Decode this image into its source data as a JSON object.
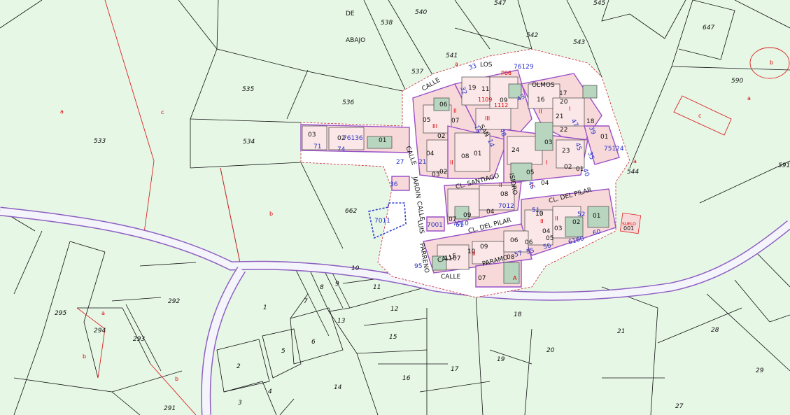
{
  "map": {
    "parcel_numbers": [
      "540",
      "547",
      "545",
      "647",
      "538",
      "542",
      "543",
      "541",
      "537",
      "590",
      "535",
      "536",
      "533",
      "534",
      "591",
      "544",
      "662",
      "295",
      "292",
      "294",
      "293",
      "291",
      "1",
      "2",
      "3",
      "4",
      "5",
      "6",
      "7",
      "8",
      "9",
      "10",
      "11",
      "12",
      "13",
      "14",
      "15",
      "16",
      "17",
      "18",
      "19",
      "20",
      "21",
      "27",
      "28",
      "29"
    ],
    "subparcel_letters": [
      "a",
      "b",
      "c"
    ],
    "street_labels": [
      "DE",
      "ABAJO",
      "CALLE",
      "LOS",
      "OLMOS",
      "CALLE",
      "SAN",
      "ISIDRO",
      "CL. SANTIAGO",
      "CL. DEL PILAR",
      "CL. DEL PILAR",
      "CALLE",
      "JARDIN",
      "CALLE",
      "LUIS",
      "PARRENO",
      "CALLE",
      "PARAMO"
    ],
    "building_numbers": [
      "03",
      "02",
      "01",
      "05",
      "06",
      "07",
      "19",
      "11",
      "09",
      "16",
      "17",
      "20",
      "21",
      "22",
      "23",
      "18",
      "01",
      "02",
      "04",
      "03",
      "02",
      "08",
      "01",
      "24",
      "05",
      "03",
      "04",
      "08",
      "01",
      "02",
      "07",
      "09",
      "10",
      "13",
      "06",
      "05",
      "04",
      "03",
      "02",
      "04",
      "01",
      "07",
      "10",
      "09",
      "11",
      "06",
      "07",
      "08"
    ],
    "blue_labels": [
      "71",
      "74",
      "76136",
      "27",
      "21",
      "75124",
      "33",
      "32",
      "15",
      "14",
      "48",
      "43",
      "47",
      "46",
      "45",
      "40",
      "39",
      "35",
      "36",
      "7001",
      "7011",
      "7010",
      "61",
      "6160",
      "56",
      "55",
      "57",
      "60",
      "95",
      "51",
      "52",
      "7012",
      "76129",
      "7901",
      "7600"
    ],
    "red_labels": [
      "P06",
      "1109",
      "1112",
      "III",
      "II",
      "I",
      "A"
    ],
    "suelo_label": "SUELO",
    "suelo_number": "001",
    "colors": {
      "background": "#e6f7e6",
      "urban_fill": "#ffffff",
      "block_fill": "#f8d9d9",
      "block_outline": "#9a50c8",
      "parcel_line": "#111111",
      "boundary_red": "#dd2222",
      "label_blue": "#2830c8"
    }
  }
}
